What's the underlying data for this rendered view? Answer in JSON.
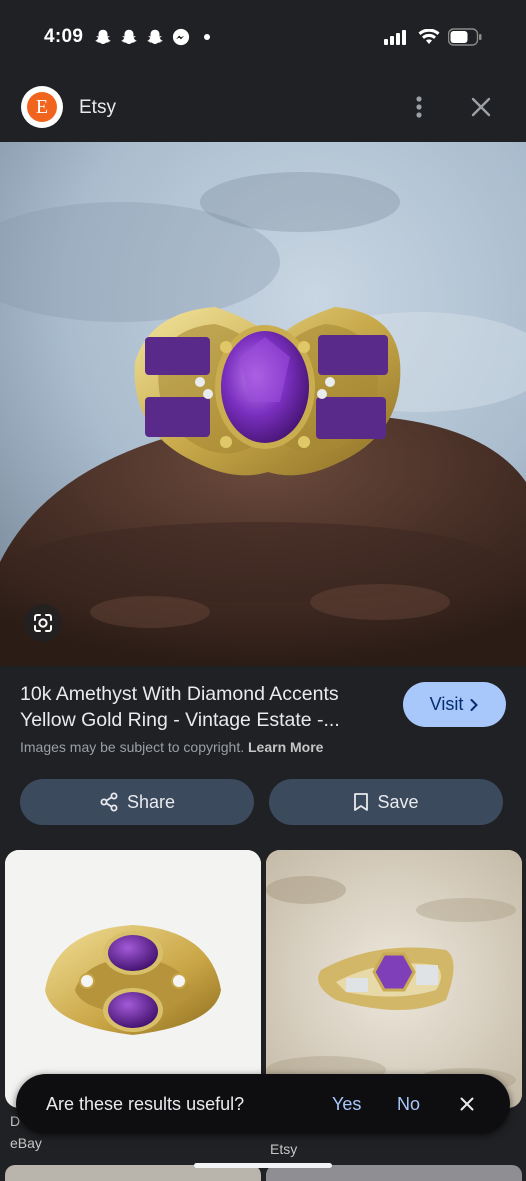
{
  "status": {
    "time": "4:09",
    "notifications": [
      "snapchat-icon",
      "snapchat-icon",
      "snapchat-icon",
      "messenger-icon",
      "dot-icon"
    ],
    "system": [
      "signal-icon",
      "wifi-icon",
      "battery-icon"
    ]
  },
  "header": {
    "logo_letter": "E",
    "title": "Etsy"
  },
  "result": {
    "title_line1": "10k Amethyst With Diamond Accents",
    "title_line2": "Yellow Gold Ring - Vintage Estate -...",
    "visit_label": "Visit",
    "copyright_text": "Images may be subject to copyright.",
    "learn_more": "Learn More"
  },
  "actions": {
    "share_label": "Share",
    "save_label": "Save"
  },
  "related": [
    {
      "title_partial": "D",
      "source": "eBay"
    },
    {
      "source": "Etsy"
    }
  ],
  "feedback": {
    "question": "Are these results useful?",
    "yes": "Yes",
    "no": "No"
  },
  "colors": {
    "background": "#202124",
    "accent": "#a8c7fa",
    "button_bg": "#3c4a5e",
    "etsy_orange": "#f1641e"
  }
}
